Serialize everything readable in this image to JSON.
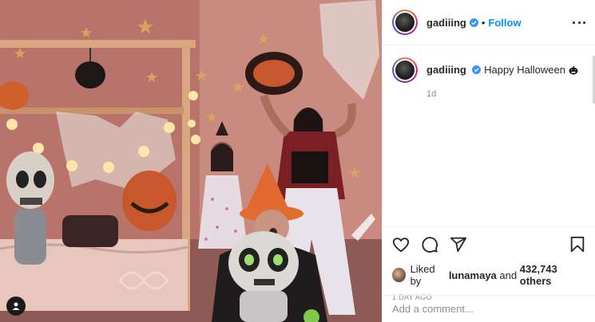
{
  "post": {
    "author": "gadiiing",
    "follow_label": "Follow",
    "separator": "•",
    "caption": "Happy Halloween",
    "caption_emoji": "jack-o-lantern",
    "time_ago": "1d",
    "liked_by_prefix": "Liked by",
    "liked_by_user": "lunamaya",
    "liked_by_suffix": "and",
    "like_count": "432,743 others",
    "date": "1 DAY AGO",
    "comment_placeholder": "Add a comment..."
  },
  "icons": {
    "more": "more-options-icon",
    "verified": "verified-badge-icon",
    "like": "heart-icon",
    "comment": "comment-icon",
    "share": "share-icon",
    "save": "bookmark-icon",
    "tags": "user-tag-icon"
  },
  "colors": {
    "accent": "#0095f6",
    "text": "#262626",
    "muted": "#8e8e8e",
    "border": "#efefef"
  }
}
